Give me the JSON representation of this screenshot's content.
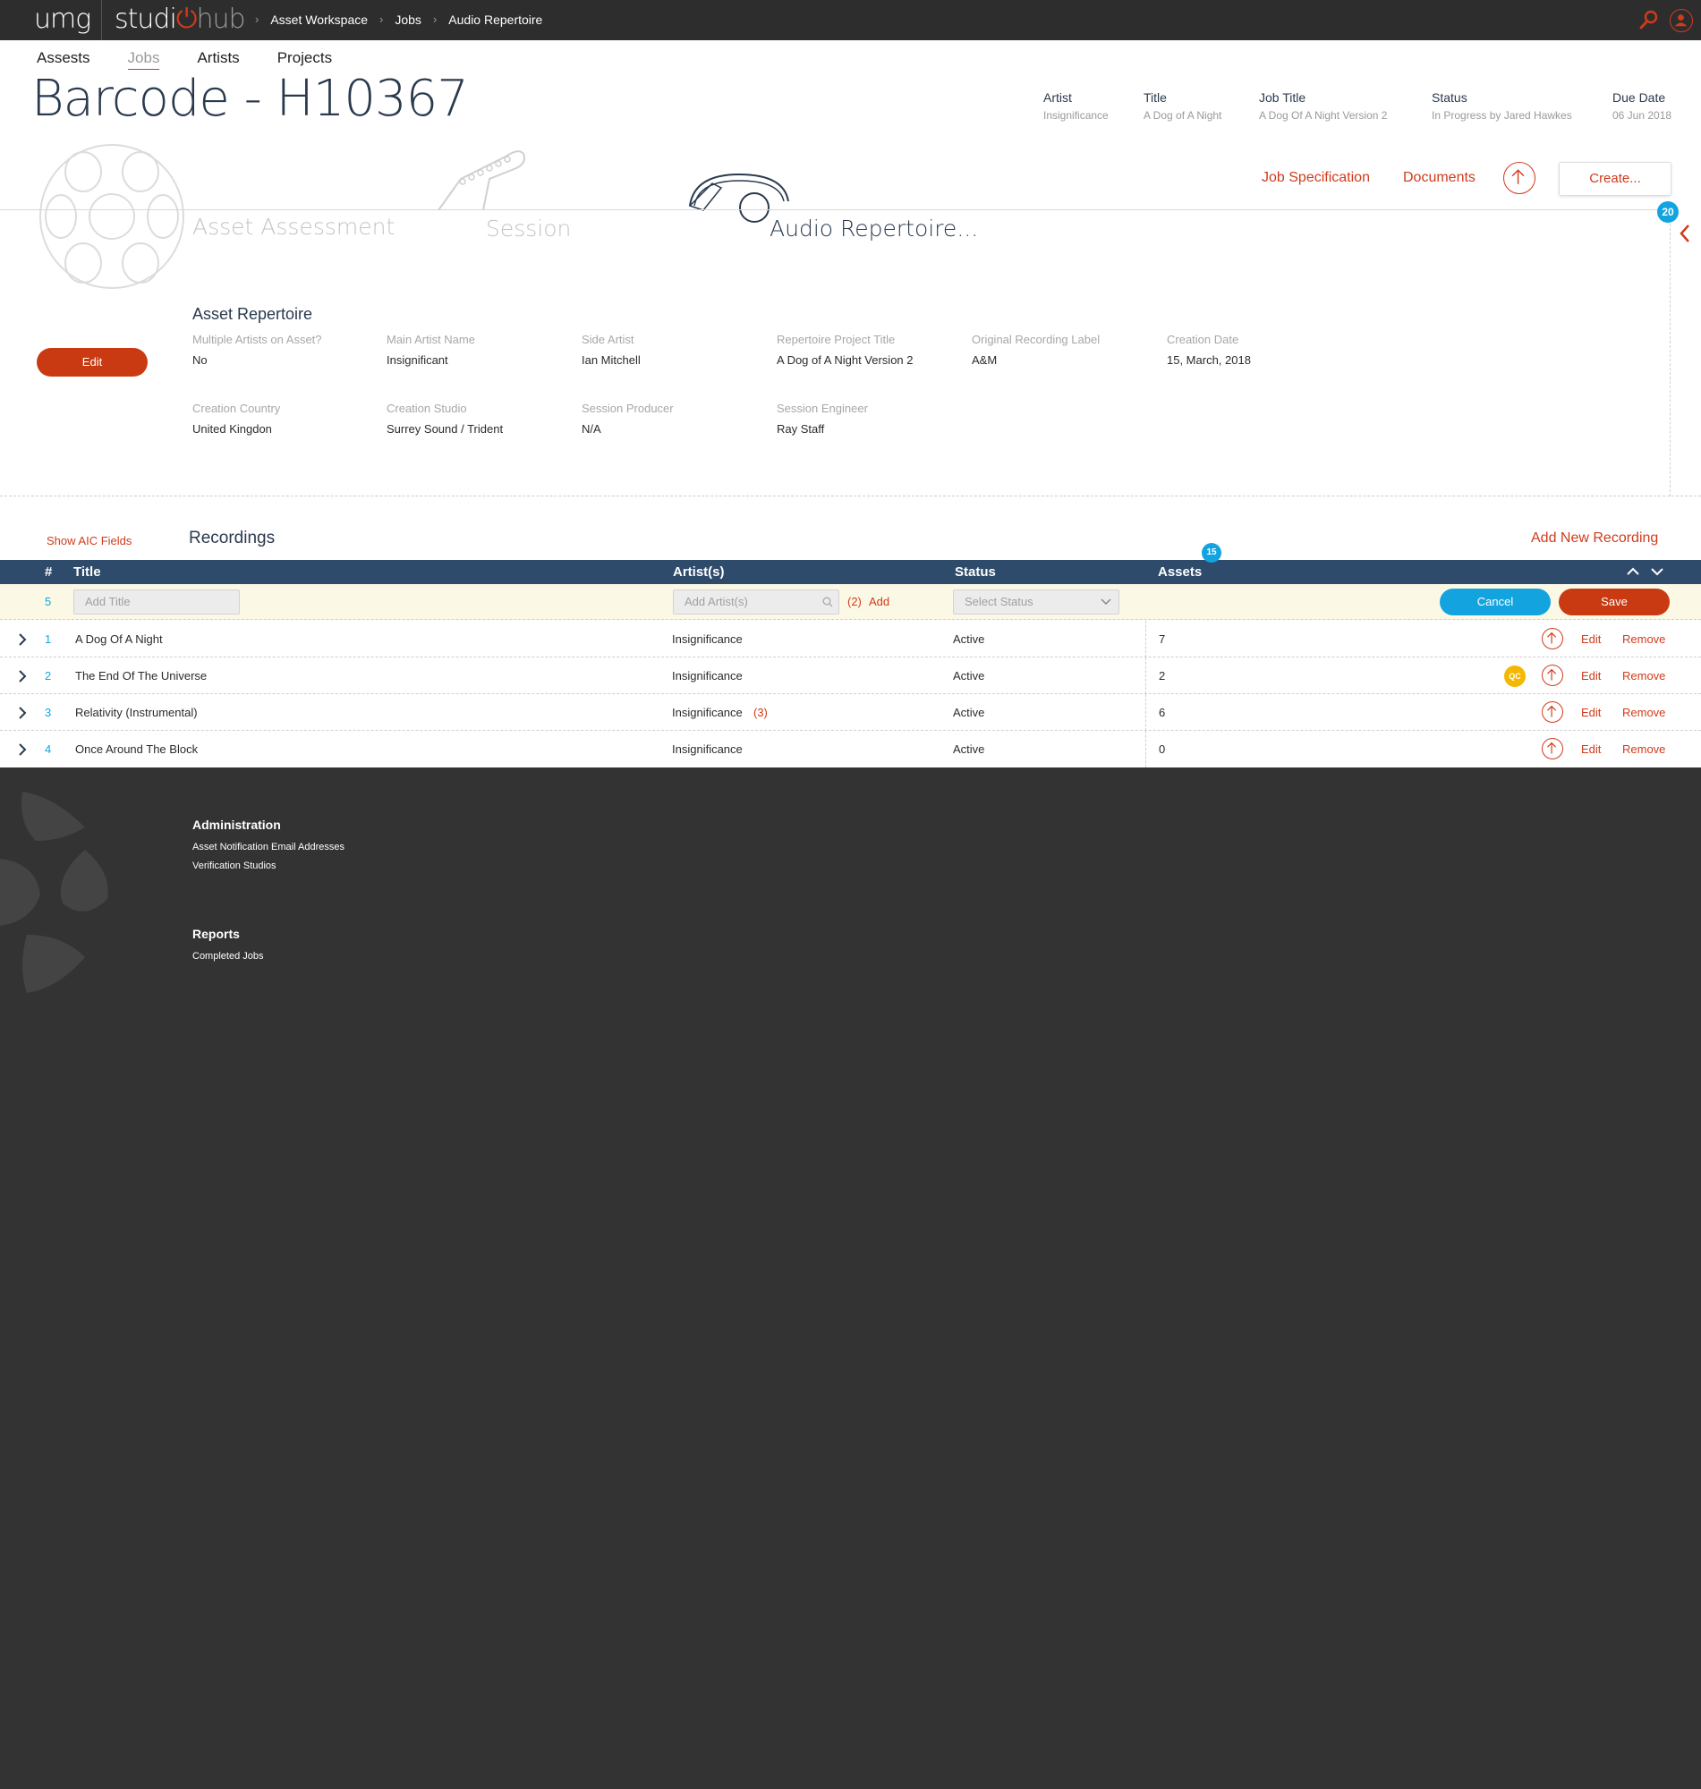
{
  "topbar": {
    "logo_umg": "umg",
    "logo_studio": "studi",
    "logo_hub": "hub",
    "breadcrumb": [
      "Asset Workspace",
      "Jobs",
      "Audio Repertoire"
    ]
  },
  "nav": {
    "items": [
      "Assests",
      "Jobs",
      "Artists",
      "Projects"
    ],
    "active": "Jobs"
  },
  "page_title": "Barcode - H10367",
  "meta": [
    {
      "label": "Artist",
      "value": "Insignificance"
    },
    {
      "label": "Title",
      "value": "A Dog of A Night"
    },
    {
      "label": "Job Title",
      "value": "A Dog Of A Night Version 2"
    },
    {
      "label": "Status",
      "value": "In Progress by Jared Hawkes"
    },
    {
      "label": "Due Date",
      "value": "06 Jun 2018"
    }
  ],
  "actions": {
    "job_spec": "Job Specification",
    "documents": "Documents",
    "create": "Create..."
  },
  "badge_count": "20",
  "steps": [
    "Asset Assessment",
    "Session",
    "Audio Repertoire..."
  ],
  "section": {
    "title": "Asset Repertoire",
    "edit_label": "Edit",
    "fields": [
      {
        "label": "Multiple Artists on Asset?",
        "value": "No"
      },
      {
        "label": "Main Artist Name",
        "value": "Insignificant"
      },
      {
        "label": "Side Artist",
        "value": "Ian Mitchell"
      },
      {
        "label": "Repertoire Project Title",
        "value": "A Dog of A Night Version 2"
      },
      {
        "label": "Original Recording Label",
        "value": "A&M"
      },
      {
        "label": "Creation Date",
        "value": "15, March, 2018"
      },
      {
        "label": "Creation Country",
        "value": "United Kingdon"
      },
      {
        "label": "Creation Studio",
        "value": "Surrey Sound / Trident"
      },
      {
        "label": "Session Producer",
        "value": "N/A"
      },
      {
        "label": "Session Engineer",
        "value": "Ray Staff"
      }
    ]
  },
  "recordings": {
    "show_aic": "Show AIC Fields",
    "title": "Recordings",
    "add_new": "Add New Recording",
    "assets_badge": "15",
    "columns": [
      "#",
      "Title",
      "Artist(s)",
      "Status",
      "Assets"
    ],
    "new_row": {
      "num": "5",
      "title_placeholder": "Add Title",
      "artist_placeholder": "Add Artist(s)",
      "artist_count": "(2)",
      "add_label": "Add",
      "status_placeholder": "Select Status",
      "cancel": "Cancel",
      "save": "Save"
    },
    "rows": [
      {
        "num": "1",
        "title": "A Dog Of A Night",
        "artist": "Insignificance",
        "artist_extra": "",
        "status": "Active",
        "assets": "7",
        "qc": ""
      },
      {
        "num": "2",
        "title": "The End Of The Universe",
        "artist": "Insignificance",
        "artist_extra": "",
        "status": "Active",
        "assets": "2",
        "qc": "QC"
      },
      {
        "num": "3",
        "title": "Relativity (Instrumental)",
        "artist": "Insignificance",
        "artist_extra": "(3)",
        "status": "Active",
        "assets": "6",
        "qc": ""
      },
      {
        "num": "4",
        "title": "Once Around The Block",
        "artist": "Insignificance",
        "artist_extra": "",
        "status": "Active",
        "assets": "0",
        "qc": ""
      }
    ],
    "row_edit": "Edit",
    "row_remove": "Remove"
  },
  "footer": {
    "admin_title": "Administration",
    "admin_links": [
      "Asset Notification Email Addresses",
      "Verification Studios"
    ],
    "reports_title": "Reports",
    "reports_links": [
      "Completed Jobs"
    ]
  },
  "colors": {
    "accent": "#d13b1b",
    "navy": "#2e4b6b",
    "blue": "#13a4e0",
    "qc": "#f5b800",
    "topbar": "#2d2d2d"
  }
}
